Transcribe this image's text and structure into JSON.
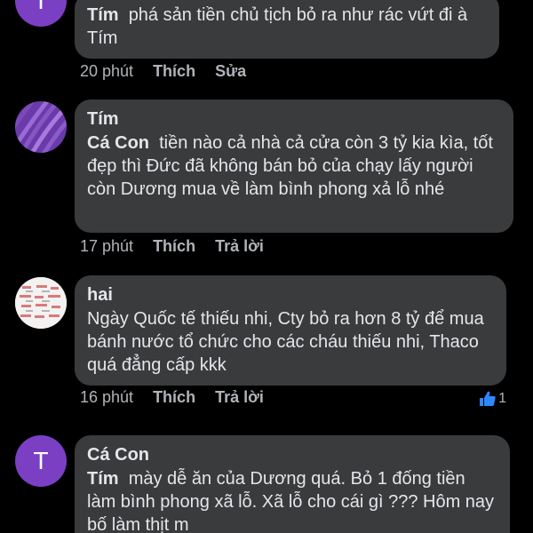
{
  "comments": [
    {
      "avatar_letter": "T",
      "reply_to": "Tím",
      "text": "phá sản tiền chủ tịch bỏ ra như rác vứt đi à Tím",
      "time": "20 phút",
      "like": "Thích",
      "action": "Sửa"
    },
    {
      "author": "Tím",
      "reply_to": "Cá Con",
      "text": "tiền nào cả nhà cả cửa còn 3 tỷ kia kìa, tốt đẹp thì Đức đã không bán bỏ của chạy lấy người còn Dương mua về làm bình phong xả lỗ nhé",
      "time": "17 phút",
      "like": "Thích",
      "action": "Trả lời"
    },
    {
      "author": "hai",
      "text": "Ngày Quốc tế thiếu nhi, Cty bỏ ra hơn 8 tỷ để mua bánh nước tổ chức cho các cháu thiếu nhi, Thaco quá đẳng cấp kkk",
      "time": "16 phút",
      "like": "Thích",
      "action": "Trả lời",
      "reaction_count": "1"
    },
    {
      "avatar_letter": "T",
      "author": "Cá Con",
      "reply_to": "Tím",
      "text": "mày dễ ăn của Dương quá. Bỏ 1 đống tiền làm bình phong xã lỗ. Xã lỗ cho cái gì ??? Hôm nay bố làm thịt m"
    }
  ],
  "colors": {
    "background": "#000000",
    "bubble": "#3a3b3c",
    "text": "#e4e6eb",
    "muted": "#b0b3b8",
    "avatar_purple": "#7b3fc4",
    "like_blue": "#2d88ff"
  }
}
